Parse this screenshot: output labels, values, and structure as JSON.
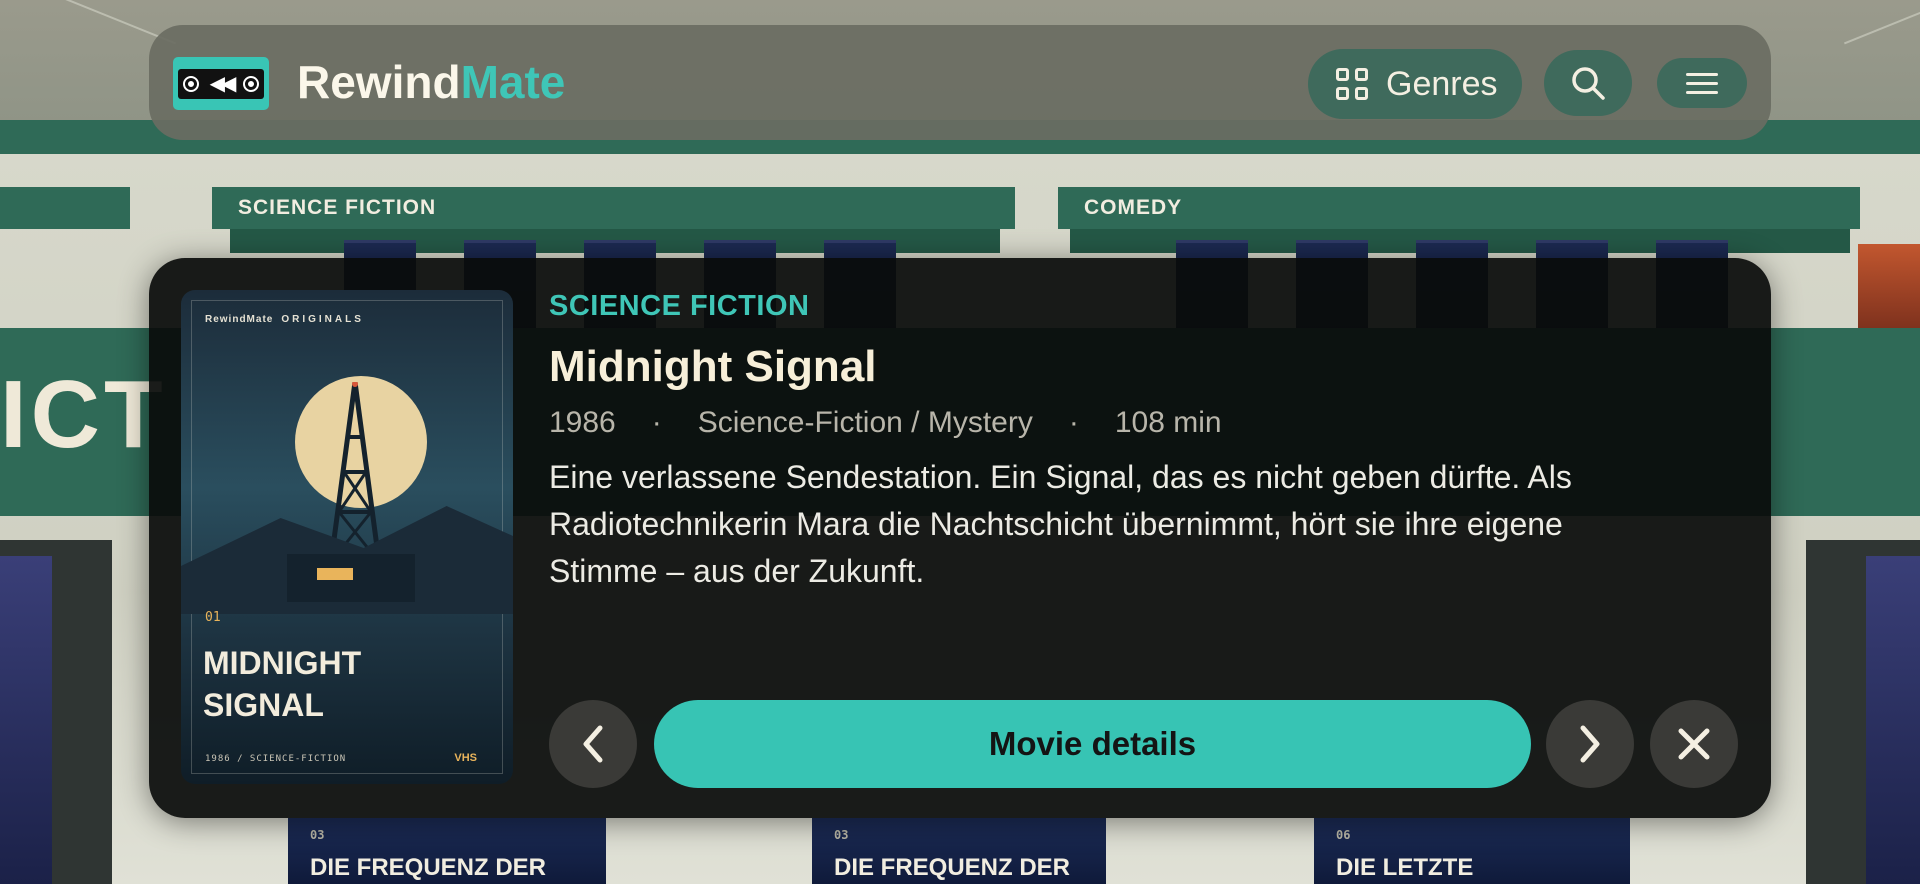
{
  "nav": {
    "brand_first": "Rewind",
    "brand_second": "Mate",
    "genres_label": "Genres",
    "icons": [
      "cassette-logo-icon",
      "grid-icon",
      "search-icon",
      "menu-icon"
    ]
  },
  "background": {
    "shelf_signs": [
      "SCIENCE FICTION",
      "COMEDY"
    ],
    "band_text": "ICT",
    "tapes": [
      {
        "num": "03",
        "title": "DIE FREQUENZ DER"
      },
      {
        "num": "03",
        "title": "DIE FREQUENZ DER"
      },
      {
        "num": "06",
        "title": "DIE LETZTE"
      }
    ]
  },
  "card": {
    "poster": {
      "brand": "RewindMate",
      "brand_tag": "ORIGINALS",
      "number": "01",
      "title_line1": "MIDNIGHT",
      "title_line2": "SIGNAL",
      "footer": "1986  /  SCIENCE-FICTION",
      "format": "VHS"
    },
    "genre": "SCIENCE FICTION",
    "title": "Midnight Signal",
    "year": "1986",
    "genres": "Science-Fiction / Mystery",
    "runtime": "108 min",
    "separator": "·",
    "synopsis": "Eine verlassene Sendestation. Ein Signal, das es nicht geben dürfte. Als Radiotechnikerin Mara die Nachtschicht übernimmt, hört sie ihre eigene Stimme – aus der Zukunft.",
    "details_button": "Movie details",
    "accent_color": "#37c4b4"
  }
}
